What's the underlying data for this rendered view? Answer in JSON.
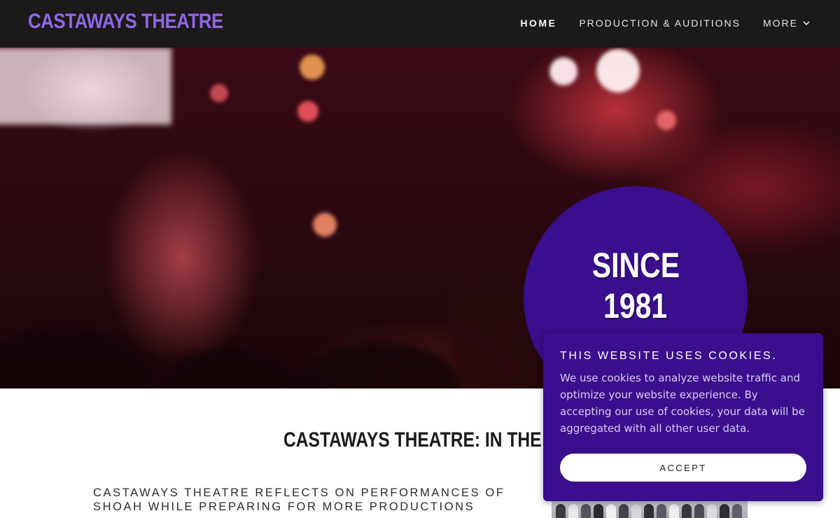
{
  "header": {
    "logo": "CASTAWAYS THEATRE",
    "nav": [
      {
        "label": "HOME"
      },
      {
        "label": "PRODUCTION & AUDITIONS"
      },
      {
        "label": "MORE"
      }
    ]
  },
  "hero": {
    "badge_line1": "SINCE",
    "badge_line2": "1981"
  },
  "news": {
    "heading": "CASTAWAYS THEATRE: IN THE NEWS",
    "article_title": "CASTAWAYS THEATRE REFLECTS ON PERFORMANCES OF SHOAH WHILE PREPARING FOR MORE PRODUCTIONS"
  },
  "cookie": {
    "title": "THIS WEBSITE USES COOKIES.",
    "body": "We use cookies to analyze website traffic and optimize your website experience. By accepting our use of cookies, your data will be aggregated with all other user data.",
    "accept_label": "ACCEPT"
  },
  "colors": {
    "logo": "#8f66e8",
    "header_bg": "#1b1919",
    "purple": "#3a0e8c"
  },
  "icons": {
    "more": "chevron-down-icon"
  }
}
